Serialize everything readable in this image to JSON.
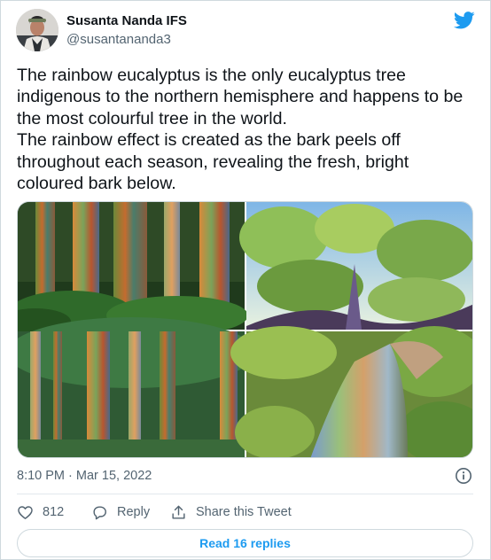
{
  "author": {
    "display_name": "Susanta Nanda IFS",
    "handle": "@susantananda3"
  },
  "brand_color": "#1d9bf0",
  "tweet": {
    "lines": [
      "The rainbow eucalyptus is the only eucalyptus tree indigenous to the northern hemisphere and happens to be the most colourful tree in the world.",
      "The rainbow effect is created as the bark peels off throughout each season, revealing the fresh, bright coloured bark below."
    ]
  },
  "meta": {
    "timestamp": "8:10 PM · Mar 15, 2022"
  },
  "actions": {
    "like_count": "812",
    "reply_label": "Reply",
    "share_label": "Share this Tweet"
  },
  "replies_button": "Read 16 replies",
  "icons": {
    "platform": "twitter-bird-icon",
    "info": "info-icon",
    "like": "heart-icon",
    "reply": "speech-bubble-icon",
    "share": "share-arrow-icon"
  }
}
